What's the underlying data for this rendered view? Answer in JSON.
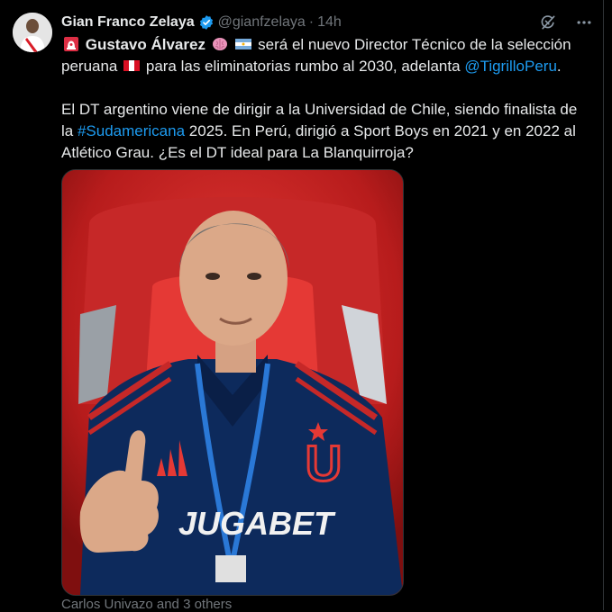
{
  "tweet": {
    "author_name": "Gian Franco Zelaya",
    "handle": "@gianfzelaya",
    "separator": "·",
    "time": "14h",
    "text": {
      "p1_name": "Gustavo Álvarez",
      "p1_part1": "será el nuevo Director Técnico de la selección peruana",
      "p1_part2": "para las eliminatorias rumbo al 2030, adelanta",
      "mention": "@TigrilloPeru",
      "p1_end": ".",
      "p2_part1": "El DT argentino viene de dirigir a la Universidad de Chile, siendo finalista de la",
      "hashtag": "#Sudamericana",
      "p2_part2": "2025. En Perú, dirigió a Sport Boys en 2021 y en 2022 al Atlético Grau. ¿Es el DT ideal para La Blanquirroja?"
    },
    "media": {
      "jersey_sponsor": "JUGABET",
      "crest_letter": "U"
    },
    "tagged_people": "Carlos Univazo and 3 others"
  },
  "icons": {
    "verified": "verified-badge-icon",
    "grok": "grok-icon",
    "more": "more-icon",
    "siren": "siren-emoji",
    "brain": "brain-emoji",
    "argentina_flag": "argentina-flag-emoji",
    "peru_flag": "peru-flag-emoji"
  },
  "colors": {
    "background": "#000000",
    "text": "#e7e9ea",
    "secondary": "#71767b",
    "link": "#1d9bf0",
    "border": "#2f3336"
  }
}
